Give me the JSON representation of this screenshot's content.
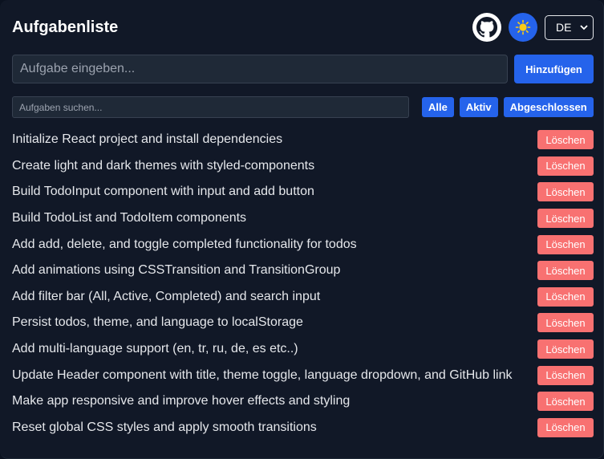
{
  "header": {
    "title": "Aufgabenliste",
    "github_icon": "github-icon",
    "theme_icon": "sun-icon",
    "language": "DE"
  },
  "input": {
    "placeholder": "Aufgabe eingeben...",
    "value": "",
    "add_label": "Hinzufügen"
  },
  "search": {
    "placeholder": "Aufgaben suchen...",
    "value": ""
  },
  "filters": [
    "Alle",
    "Aktiv",
    "Abgeschlossen"
  ],
  "todos": [
    {
      "text": "Initialize React project and install dependencies",
      "delete_label": "Löschen"
    },
    {
      "text": "Create light and dark themes with styled-components",
      "delete_label": "Löschen"
    },
    {
      "text": "Build TodoInput component with input and add button",
      "delete_label": "Löschen"
    },
    {
      "text": "Build TodoList and TodoItem components",
      "delete_label": "Löschen"
    },
    {
      "text": "Add add, delete, and toggle completed functionality for todos",
      "delete_label": "Löschen"
    },
    {
      "text": "Add animations using CSSTransition and TransitionGroup",
      "delete_label": "Löschen"
    },
    {
      "text": "Add filter bar (All, Active, Completed) and search input",
      "delete_label": "Löschen"
    },
    {
      "text": "Persist todos, theme, and language to localStorage",
      "delete_label": "Löschen"
    },
    {
      "text": "Add multi-language support (en, tr, ru, de, es etc..)",
      "delete_label": "Löschen"
    },
    {
      "text": "Update Header component with title, theme toggle, language dropdown, and GitHub link",
      "delete_label": "Löschen"
    },
    {
      "text": "Make app responsive and improve hover effects and styling",
      "delete_label": "Löschen"
    },
    {
      "text": "Reset global CSS styles and apply smooth transitions",
      "delete_label": "Löschen"
    }
  ],
  "colors": {
    "background": "#111827",
    "accent": "#2563eb",
    "delete": "#f87171",
    "sun": "#facc15"
  }
}
